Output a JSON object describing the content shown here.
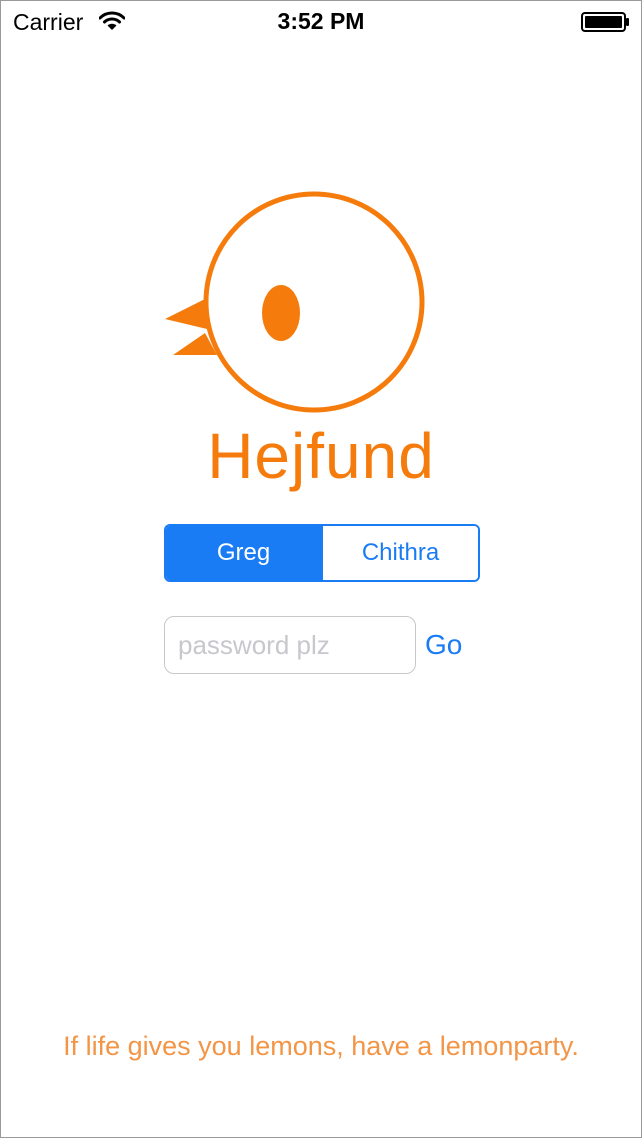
{
  "status_bar": {
    "carrier": "Carrier",
    "time": "3:52 PM",
    "wifi_icon": "wifi-icon",
    "battery_icon": "battery-icon"
  },
  "logo": {
    "icon": "bird-logo-icon",
    "color": "#f57c0c"
  },
  "brand": {
    "name": "Hejfund"
  },
  "user_selector": {
    "options": [
      "Greg",
      "Chithra"
    ],
    "selected": "Greg",
    "accent_color": "#1a7cf5"
  },
  "login": {
    "password_placeholder": "password plz",
    "password_value": "",
    "go_label": "Go"
  },
  "tagline": {
    "text": "If life gives you lemons, have a lemonparty.",
    "color": "#f29546"
  }
}
